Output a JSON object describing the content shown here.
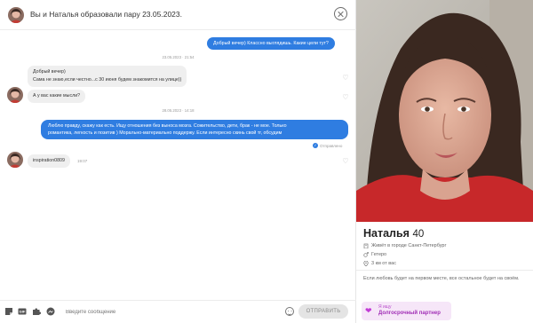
{
  "header": {
    "title": "Вы и Наталья образовали пару 23.05.2023."
  },
  "messages": {
    "m1": "Добрый вечер) Классно выглядишь. Какие цели тут?",
    "date1": "23.05.2023 · 21:54",
    "m2_line1": "Добрый вечер)",
    "m2_line2": "Сама не знаю,если честно...с 30 июня будем знакомится на улице))",
    "m3": "А у вас какие мысли?",
    "date2": "28.05.2023 · 14:18",
    "m4_line1": "Люблю правду, скажу как есть. Ищу отношения без выноса мозга. Сожительство, дети, брак - не мое. Только",
    "m4_line2": "романтика, легкость и позитив ) Морально-материально поддержу. Если интересно скинь свой тг, обсудим",
    "sent_status": "Отправлено",
    "m5": "inspiration0809",
    "m5_time": "19:07"
  },
  "composer": {
    "placeholder": "Введите сообщение",
    "send_label": "ОТПРАВИТЬ"
  },
  "profile": {
    "name": "Наталья",
    "age": "40",
    "city": "Живёт в городе Санкт-Петербург",
    "orientation": "Гетеро",
    "distance": "3 км от вас",
    "about": "Если любовь будет на первом месте, все остальное будет на своём.",
    "goal_heading": "Я ищу",
    "goal_value": "Долгосрочный партнер"
  },
  "colors": {
    "accent": "#2f7de1",
    "goal_text": "#a12fb6",
    "goal_bg": "#f6e6f8"
  },
  "icons": {
    "close": "close-icon",
    "like": "heart-icon",
    "sticker": "sticker-icon",
    "gif": "gif-icon",
    "puzzle": "puzzle-icon",
    "image": "image-icon",
    "emoji": "emoji-icon",
    "city": "building-icon",
    "orientation": "gender-icon",
    "distance": "location-pin-icon",
    "goal": "hearts-icon"
  }
}
